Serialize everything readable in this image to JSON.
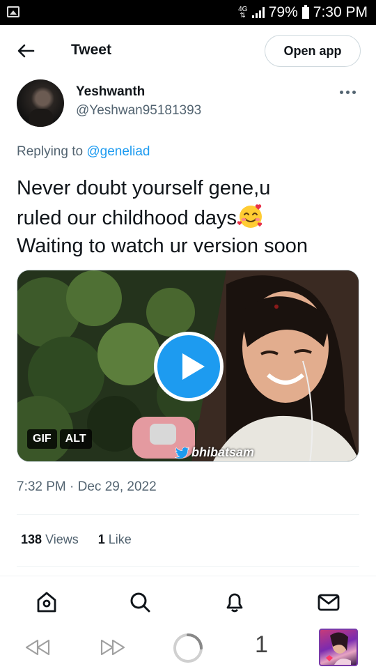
{
  "status_bar": {
    "network": "4G",
    "battery": "79%",
    "time": "7:30 PM"
  },
  "header": {
    "title": "Tweet",
    "open_app_label": "Open app"
  },
  "tweet": {
    "author_name": "Yeshwanth",
    "author_handle": "@Yeshwan95181393",
    "replying_prefix": "Replying to",
    "replying_handle": "@geneliad",
    "text_line1": "Never doubt yourself gene,u",
    "text_line2": "ruled our childhood days",
    "text_line3": "Waiting to watch ur version soon",
    "media_badges": [
      "GIF",
      "ALT"
    ],
    "media_watermark": "bhibatsam",
    "timestamp": "7:32 PM · Dec 29, 2022",
    "views_count": "138",
    "views_label": "Views",
    "likes_count": "1",
    "likes_label": "Like"
  },
  "bottom_nav": [
    "home-icon",
    "search-icon",
    "notifications-icon",
    "messages-icon"
  ],
  "browser_bar": {
    "tab_count": "1"
  },
  "colors": {
    "accent": "#1d9bf0",
    "text": "#0f1419",
    "muted": "#536471"
  }
}
